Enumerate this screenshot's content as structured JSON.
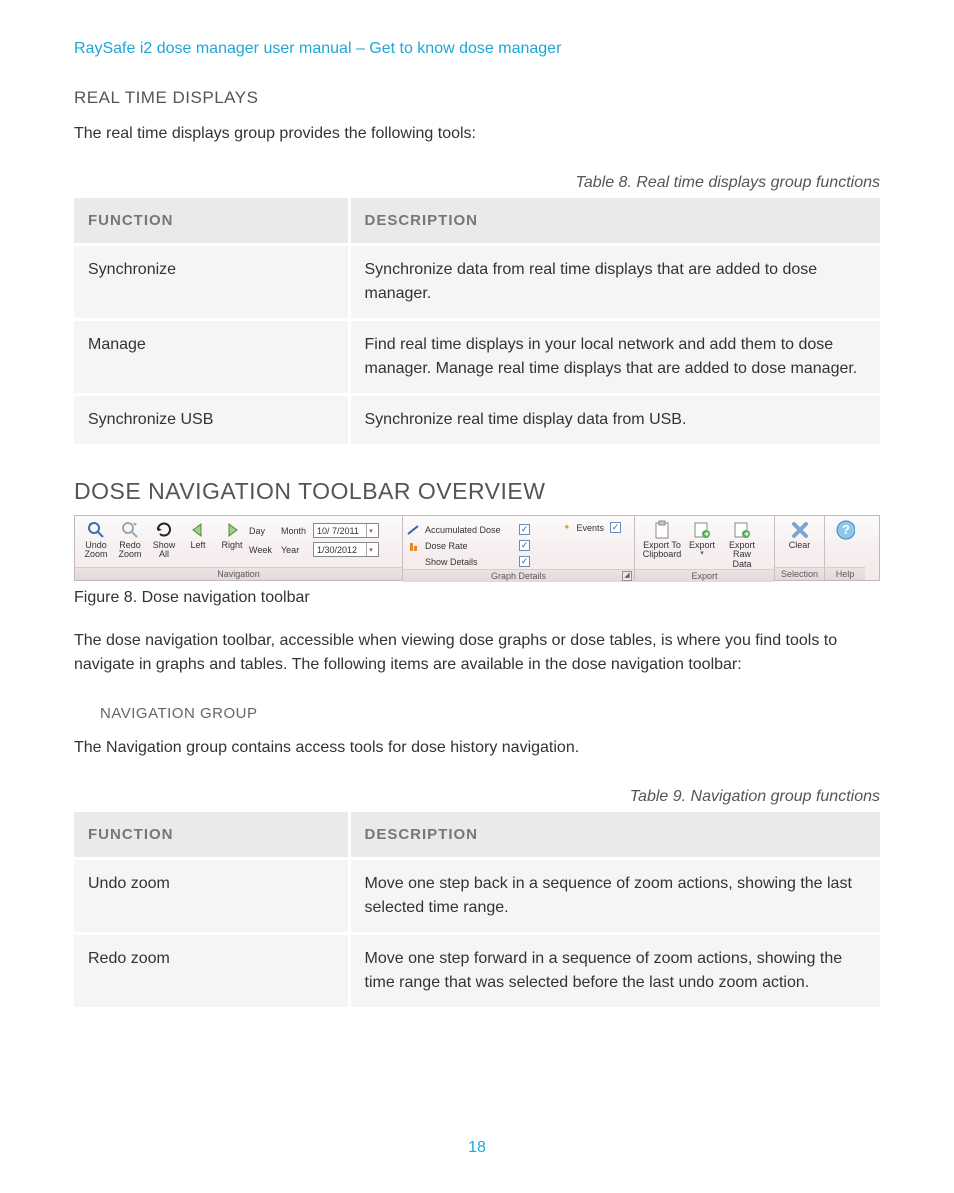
{
  "breadcrumb": "RaySafe i2 dose manager user manual – Get to know dose manager",
  "section_rtd_heading": "REAL TIME DISPLAYS",
  "section_rtd_intro": "The real time displays group provides the following tools:",
  "table8_caption": "Table 8.    Real time displays group functions",
  "table_headers": {
    "func": "FUNCTION",
    "desc": "DESCRIPTION"
  },
  "table8_rows": [
    {
      "func": "Synchronize",
      "desc": "Synchronize data from real time displays that are added to dose manager."
    },
    {
      "func": "Manage",
      "desc": "Find real time displays in your local network and add them to dose manager. Manage real time displays that are added to dose manager."
    },
    {
      "func": "Synchronize USB",
      "desc": "Synchronize real time display data from USB."
    }
  ],
  "section_overview_heading": "DOSE NAVIGATION TOOLBAR OVERVIEW",
  "figure8_caption": "Figure 8.    Dose navigation toolbar",
  "overview_body": "The dose navigation toolbar, accessible when viewing dose graphs or dose tables, is where you find tools to navigate in graphs and tables. The following items are available in the dose navigation toolbar:",
  "nav_group_heading": "NAVIGATION GROUP",
  "nav_group_intro": "The Navigation group contains access tools for dose history navigation.",
  "table9_caption": "Table 9.    Navigation group functions",
  "table9_rows": [
    {
      "func": "Undo zoom",
      "desc": "Move one step back in a sequence of zoom actions, showing the last selected time range."
    },
    {
      "func": "Redo zoom",
      "desc": "Move one step forward in a sequence of zoom actions, showing the time range that was selected before the last undo zoom action."
    }
  ],
  "page_number": "18",
  "ribbon": {
    "nav": {
      "title": "Navigation",
      "undo_zoom": "Undo\nZoom",
      "redo_zoom": "Redo\nZoom",
      "show_all": "Show\nAll",
      "left": "Left",
      "right": "Right",
      "day": "Day",
      "month": "Month",
      "week": "Week",
      "year": "Year",
      "date1": "10/ 7/2011",
      "date2": "1/30/2012"
    },
    "graph": {
      "title": "Graph Details",
      "accum": "Accumulated Dose",
      "rate": "Dose Rate",
      "show_details": "Show Details",
      "events": "Events"
    },
    "export": {
      "title": "Export",
      "to_clip": "Export To\nClipboard",
      "export": "Export",
      "raw": "Export Raw\nData"
    },
    "selection": {
      "title": "Selection",
      "clear": "Clear"
    },
    "help": {
      "title": "Help"
    }
  }
}
